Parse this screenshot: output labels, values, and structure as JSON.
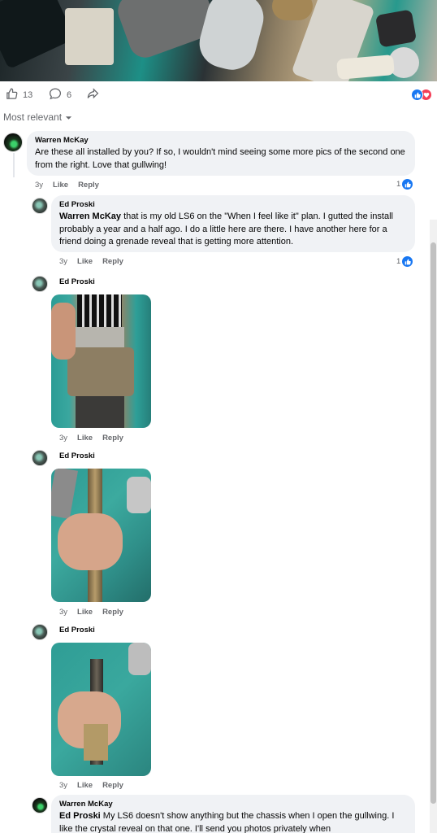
{
  "post": {
    "like_count": "13",
    "comment_count": "6",
    "reaction_colors": {
      "like": "#1877f2",
      "love": "#f33e58"
    }
  },
  "sort": {
    "label": "Most relevant"
  },
  "comments": [
    {
      "author": "Warren McKay",
      "text": "Are these all installed by you? If so, I wouldn't mind seeing some more pics of the second one from the right. Love that gullwing!",
      "time": "3y",
      "like": "Like",
      "reply": "Reply",
      "likes": "1"
    },
    {
      "author": "Ed Proski",
      "mention": "Warren McKay",
      "text": " that is my old LS6 on the \"When I feel like it\" plan. I gutted the install probably a year and a half ago. I do a little here are there. I have another here for a friend doing a grenade reveal that is getting more attention.",
      "time": "3y",
      "like": "Like",
      "reply": "Reply",
      "likes": "1"
    },
    {
      "author": "Ed Proski",
      "time": "3y",
      "like": "Like",
      "reply": "Reply"
    },
    {
      "author": "Ed Proski",
      "time": "3y",
      "like": "Like",
      "reply": "Reply"
    },
    {
      "author": "Ed Proski",
      "time": "3y",
      "like": "Like",
      "reply": "Reply"
    },
    {
      "author": "Warren McKay",
      "mention": "Ed Proski",
      "text": " My LS6 doesn't show anything but the chassis when I open the gullwing. I like the crystal reveal on that one. I'll send you photos privately when"
    }
  ]
}
